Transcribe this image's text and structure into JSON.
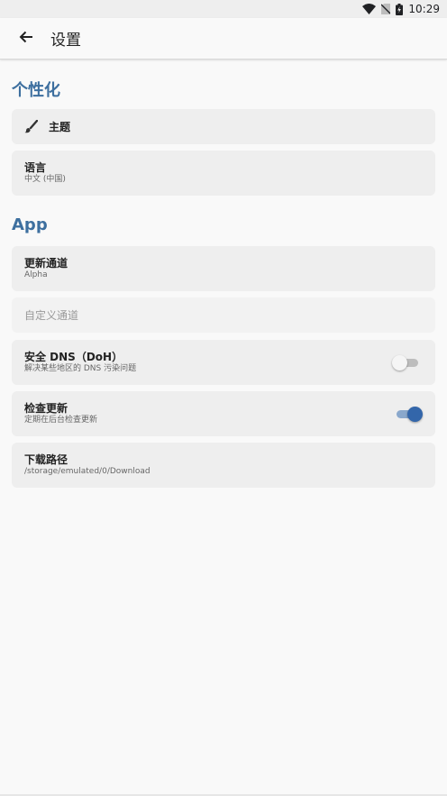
{
  "status_bar": {
    "time": "10:29"
  },
  "app_bar": {
    "title": "设置"
  },
  "sections": {
    "personalization": {
      "title": "个性化"
    },
    "app": {
      "title": "App"
    }
  },
  "items": {
    "theme": {
      "title": "主题"
    },
    "language": {
      "title": "语言",
      "subtitle": "中文 (中国)"
    },
    "update_channel": {
      "title": "更新通道",
      "subtitle": "Alpha"
    },
    "custom_channel": {
      "title": "自定义通道"
    },
    "secure_dns": {
      "title": "安全 DNS（DoH）",
      "subtitle": "解决某些地区的 DNS 污染问题",
      "enabled": false
    },
    "check_updates": {
      "title": "检查更新",
      "subtitle": "定期在后台检查更新",
      "enabled": true
    },
    "download_path": {
      "title": "下载路径",
      "subtitle": "/storage/emulated/0/Download"
    }
  },
  "colors": {
    "accent": "#3d6f9f",
    "card": "#eeeeee",
    "switch_on": "#3366aa"
  }
}
